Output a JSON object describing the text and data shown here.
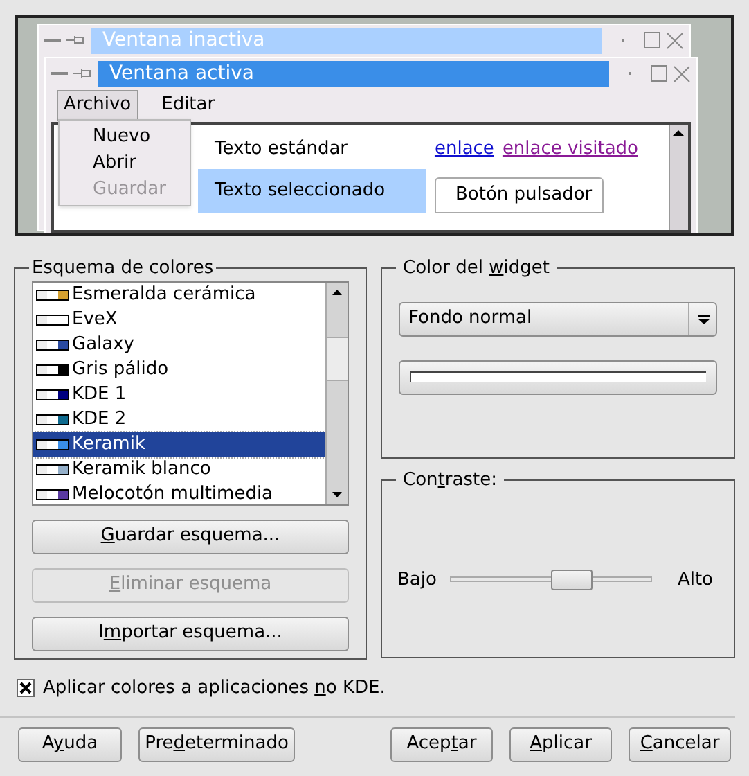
{
  "preview": {
    "inactive_title": "Ventana inactiva",
    "active_title": "Ventana activa",
    "menus": [
      {
        "label": "Archivo",
        "selected": true
      },
      {
        "label": "Editar",
        "selected": false
      }
    ],
    "menu_items": [
      {
        "label": "Nuevo",
        "disabled": false
      },
      {
        "label": "Abrir",
        "disabled": false
      },
      {
        "label": "Guardar",
        "disabled": true
      }
    ],
    "standard_text": "Texto estándar",
    "link": "enlace",
    "visited_link": "enlace visitado",
    "selected_text": "Texto seleccionado",
    "push_button": "Botón pulsador"
  },
  "scheme_group": {
    "title": "Esquema de colores",
    "items": [
      {
        "label": "Esmeralda cerámica",
        "color": "#d4a030",
        "selected": false
      },
      {
        "label": "EveX",
        "color": "#ffffff",
        "selected": false
      },
      {
        "label": "Galaxy",
        "color": "#2a4aa0",
        "selected": false
      },
      {
        "label": "Gris pálido",
        "color": "#000000",
        "selected": false
      },
      {
        "label": "KDE 1",
        "color": "#000080",
        "selected": false
      },
      {
        "label": "KDE 2",
        "color": "#0e6a8e",
        "selected": false
      },
      {
        "label": "Keramik",
        "color": "#3a8ee8",
        "selected": true
      },
      {
        "label": "Keramik blanco",
        "color": "#94afc9",
        "selected": false
      },
      {
        "label": "Melocotón multimedia",
        "color": "#5a3aa0",
        "selected": false
      }
    ],
    "buttons": [
      {
        "key": "G",
        "post": "uardar esquema...",
        "disabled": false
      },
      {
        "key": "E",
        "post": "liminar esquema",
        "disabled": true
      },
      {
        "pre": "I",
        "key": "m",
        "post": "portar esquema...",
        "disabled": false
      }
    ]
  },
  "widget_group": {
    "title": {
      "pre": "Color del ",
      "key": "w",
      "post": "idget"
    },
    "dropdown": "Fondo normal"
  },
  "contrast_group": {
    "title": {
      "pre": "Con",
      "key": "t",
      "post": "raste:"
    },
    "low": "Bajo",
    "high": "Alto",
    "level": 0.6
  },
  "apply_checkbox": {
    "pre": "Aplicar colores a aplicaciones ",
    "key": "n",
    "post": "o KDE.",
    "checked": true
  },
  "buttons_left": [
    {
      "pre": "A",
      "key": "y",
      "post": "uda"
    },
    {
      "pre": "Pre",
      "key": "d",
      "post": "eterminado"
    }
  ],
  "buttons_right": [
    {
      "pre": "Acep",
      "key": "t",
      "post": "ar"
    },
    {
      "key": "A",
      "post": "plicar"
    },
    {
      "key": "C",
      "post": "ancelar"
    }
  ]
}
